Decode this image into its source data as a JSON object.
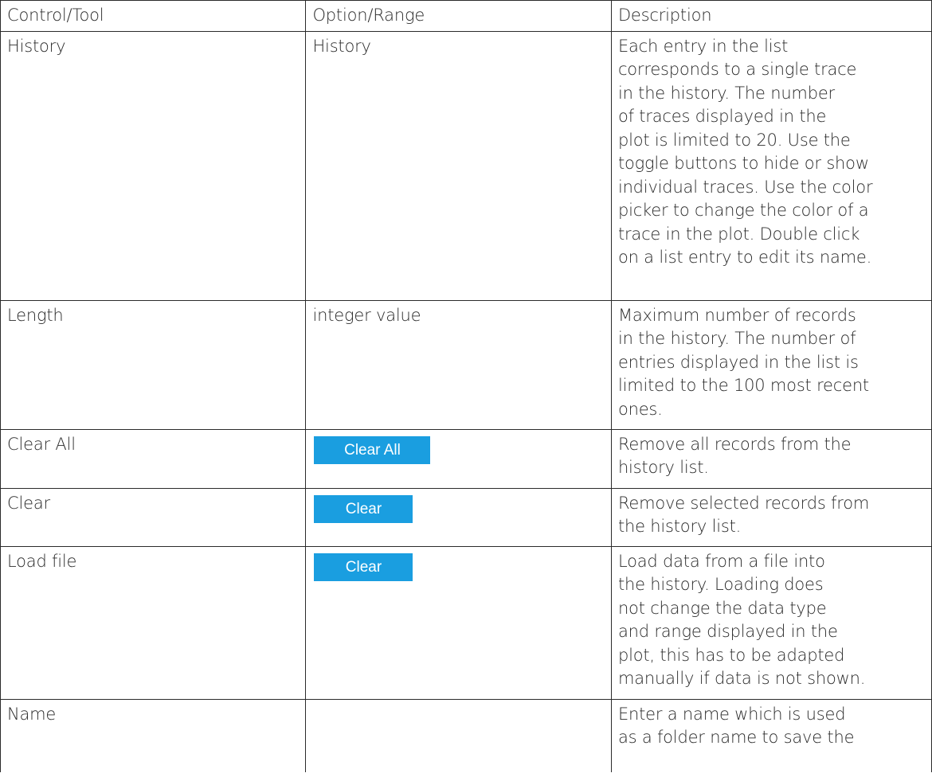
{
  "table": {
    "headers": [
      "Control/Tool",
      "Option/Range",
      "Description"
    ],
    "rows": [
      {
        "control": "History",
        "option": "History",
        "description": "Each entry in the list\ncorresponds to a single trace\nin the history. The number\nof traces displayed in the\nplot is limited to 20. Use the\ntoggle buttons to hide or show\nindividual traces. Use the color\npicker to change the color of a\ntrace in the plot. Double click\non a list entry to edit its name."
      },
      {
        "control": "Length",
        "option": "integer value",
        "description": "Maximum number of records\nin the history. The number of\nentries displayed in the list is\nlimited to the 100 most recent\nones."
      },
      {
        "control": "Clear All",
        "option_button": "Clear All",
        "description": "Remove all records from the\nhistory list."
      },
      {
        "control": "Clear",
        "option_button": "Clear",
        "description": "Remove selected records from\nthe history list."
      },
      {
        "control": "Load file",
        "option_button": "Clear",
        "description": "Load data from a file into\nthe history. Loading does\nnot change the data type\nand range displayed in the\nplot, this has to be adapted\nmanually if data is not shown."
      },
      {
        "control": "Name",
        "option": "",
        "description": "Enter a name which is used\nas a folder name to save the"
      }
    ]
  },
  "colors": {
    "button_bg": "#1a9ee0",
    "button_text": "#ffffff",
    "border": "#2b2b2b",
    "text": "#2b2b2b"
  }
}
